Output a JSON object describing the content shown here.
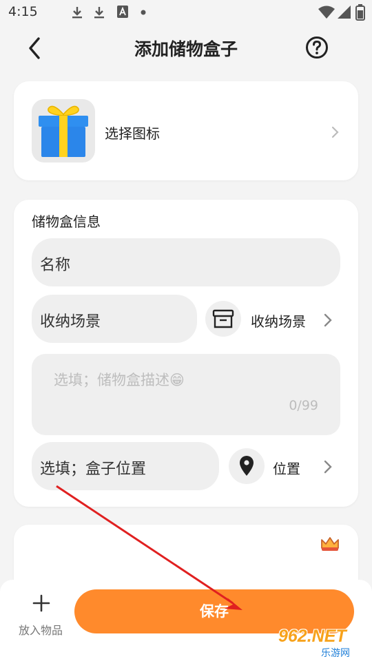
{
  "status_bar": {
    "time": "4:15",
    "icons": [
      "download-icon",
      "download-icon",
      "font-icon",
      "dot-icon",
      "wifi-icon",
      "signal-icon",
      "battery-icon"
    ]
  },
  "app_bar": {
    "title": "添加储物盒子",
    "back_icon": "back-arrow-icon",
    "help_icon": "help-icon"
  },
  "icon_picker": {
    "label": "选择图标",
    "icon": "gift-icon"
  },
  "info": {
    "section_title": "储物盒信息",
    "name_value": "名称",
    "scene_value": "收纳场景",
    "scene_select_label": "收纳场景",
    "description_placeholder": "选填；储物盒描述😁",
    "description_count": "0/99",
    "location_value": "选填；盒子位置",
    "location_select_label": "位置"
  },
  "bottom_bar": {
    "add_item_label": "放入物品",
    "save_label": "保存"
  },
  "watermark": {
    "brand": "962.NET",
    "sub": "乐游网"
  },
  "colors": {
    "accent": "#ff8a2c",
    "background": "#f4f4f4",
    "field": "#efefef",
    "annotation_arrow": "#e02020"
  }
}
